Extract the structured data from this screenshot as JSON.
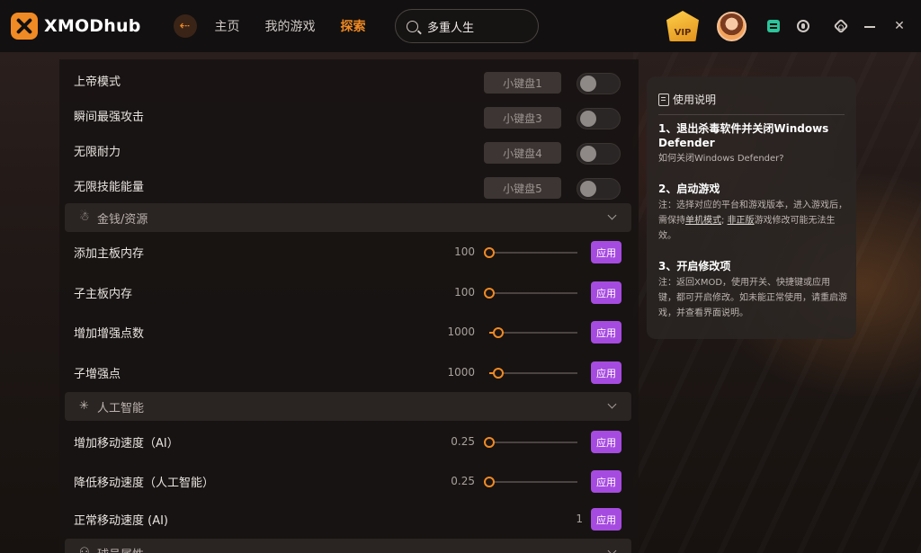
{
  "app": {
    "logo_text": "XMODhub"
  },
  "nav": {
    "back_symbol": "⇠",
    "items": [
      {
        "label": "主页",
        "active": false
      },
      {
        "label": "我的游戏",
        "active": false
      },
      {
        "label": "探索",
        "active": true
      }
    ]
  },
  "search": {
    "value": "多重人生"
  },
  "topbar": {
    "vip_label": "VIP",
    "close_symbol": "✕"
  },
  "toggles": [
    {
      "label": "上帝模式",
      "key": "小键盘1",
      "on": false
    },
    {
      "label": "瞬间最强攻击",
      "key": "小键盘3",
      "on": false
    },
    {
      "label": "无限耐力",
      "key": "小键盘4",
      "on": false
    },
    {
      "label": "无限技能能量",
      "key": "小键盘5",
      "on": false
    }
  ],
  "sections": [
    {
      "label": "金钱/资源",
      "icon": "money-bag-icon",
      "glyph": "☃"
    },
    {
      "label": "人工智能",
      "icon": "ai-icon",
      "glyph": "✳"
    },
    {
      "label": "球员属性",
      "icon": "player-icon",
      "glyph": "⚇"
    }
  ],
  "money_sliders": [
    {
      "label": "添加主板内存",
      "value": "100",
      "fraction": 0.0
    },
    {
      "label": "子主板内存",
      "value": "100",
      "fraction": 0.0
    },
    {
      "label": "增加增强点数",
      "value": "1000",
      "fraction": 0.1
    },
    {
      "label": "子增强点",
      "value": "1000",
      "fraction": 0.1
    }
  ],
  "ai_sliders": [
    {
      "label": "增加移动速度（AI）",
      "value": "0.25",
      "fraction": 0.0
    },
    {
      "label": "降低移动速度（人工智能）",
      "value": "0.25",
      "fraction": 0.0
    },
    {
      "label": "正常移动速度 (AI)",
      "value": "1"
    }
  ],
  "apply_label": "应用",
  "instructions": {
    "title": "使用说明",
    "step1_title": "1、退出杀毒软件并关闭Windows Defender",
    "step1_text": "如何关闭Windows Defender?",
    "step2_title": "2、启动游戏",
    "step2_text_a": "注：选择对应的平台和游戏版本，进入游戏后，需保持",
    "step2_link1": "单机模式",
    "step2_sep": "; ",
    "step2_link2": "非正版",
    "step2_text_b": "游戏修改可能无法生效。",
    "step3_title": "3、开启修改项",
    "step3_text": "注：返回XMOD，使用开关、快捷键或应用键，都可开启修改。如未能正常使用，请重启游戏，并查看界面说明。"
  },
  "colors": {
    "accent": "#f08a24",
    "apply": "#a64be0"
  }
}
